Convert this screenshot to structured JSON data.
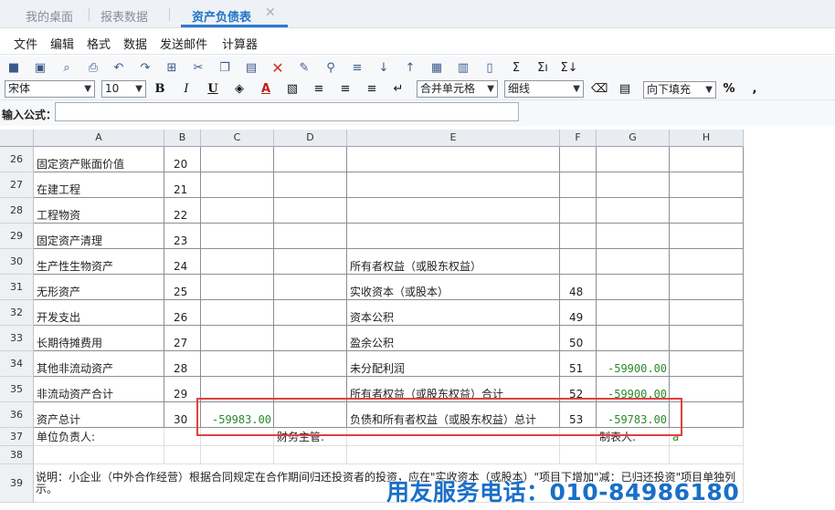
{
  "tabs": [
    {
      "label": "我的桌面"
    },
    {
      "label": "报表数据"
    },
    {
      "label": "资产负债表"
    }
  ],
  "menu": [
    "文件",
    "编辑",
    "格式",
    "数据",
    "发送邮件",
    "计算器"
  ],
  "toolbar2": {
    "font": "宋体",
    "font_size": "10",
    "merge": "合并单元格",
    "border": "细线",
    "fill": "向下填充",
    "percent": "%",
    "comma": ","
  },
  "formula": {
    "label": "输入公式：",
    "value": ""
  },
  "columns": [
    "A",
    "B",
    "C",
    "D",
    "E",
    "F",
    "G",
    "H"
  ],
  "rows": [
    {
      "num": "26",
      "a": "固定资产账面价值",
      "b": "20",
      "c": "",
      "e": "",
      "f": "",
      "g": ""
    },
    {
      "num": "27",
      "a": "在建工程",
      "b": "21",
      "c": "",
      "e": "",
      "f": "",
      "g": ""
    },
    {
      "num": "28",
      "a": "工程物资",
      "b": "22",
      "c": "",
      "e": "",
      "f": "",
      "g": ""
    },
    {
      "num": "29",
      "a": "固定资产清理",
      "b": "23",
      "c": "",
      "e": "",
      "f": "",
      "g": ""
    },
    {
      "num": "30",
      "a": "生产性生物资产",
      "b": "24",
      "c": "",
      "e": "所有者权益（或股东权益）",
      "f": "",
      "g": ""
    },
    {
      "num": "31",
      "a": "无形资产",
      "b": "25",
      "c": "",
      "e": "实收资本（或股本）",
      "f": "48",
      "g": ""
    },
    {
      "num": "32",
      "a": "开发支出",
      "b": "26",
      "c": "",
      "e": "资本公积",
      "f": "49",
      "g": ""
    },
    {
      "num": "33",
      "a": "长期待摊费用",
      "b": "27",
      "c": "",
      "e": "盈余公积",
      "f": "50",
      "g": ""
    },
    {
      "num": "34",
      "a": "其他非流动资产",
      "b": "28",
      "c": "",
      "e": "未分配利润",
      "f": "51",
      "g": "-59900.00"
    },
    {
      "num": "35",
      "a": "非流动资产合计",
      "b": "29",
      "c": "",
      "e": "所有者权益（或股东权益）合计",
      "f": "52",
      "g": "-59900.00"
    },
    {
      "num": "36",
      "a": "资产总计",
      "b": "30",
      "c": "-59983.00",
      "e": "负债和所有者权益（或股东权益）总计",
      "f": "53",
      "g": "-59783.00"
    }
  ],
  "row37": {
    "num": "37",
    "a": "单位负责人:",
    "d": "财务主管:",
    "g": "制表人:",
    "h": "a"
  },
  "row38": {
    "num": "38"
  },
  "row39": {
    "num": "39",
    "note": "说明：小企业（中外合作经营）根据合同规定在合作期间归还投资者的投资，应在\"实收资本（或股本）\"项目下增加\"减：已归还投资\"项目单独列示。"
  },
  "watermark": "用友服务电话：010-84986180",
  "colors": {
    "tab_active": "#1e73c8",
    "highlight": "#e04040",
    "value_green": "#2a8a2a"
  }
}
